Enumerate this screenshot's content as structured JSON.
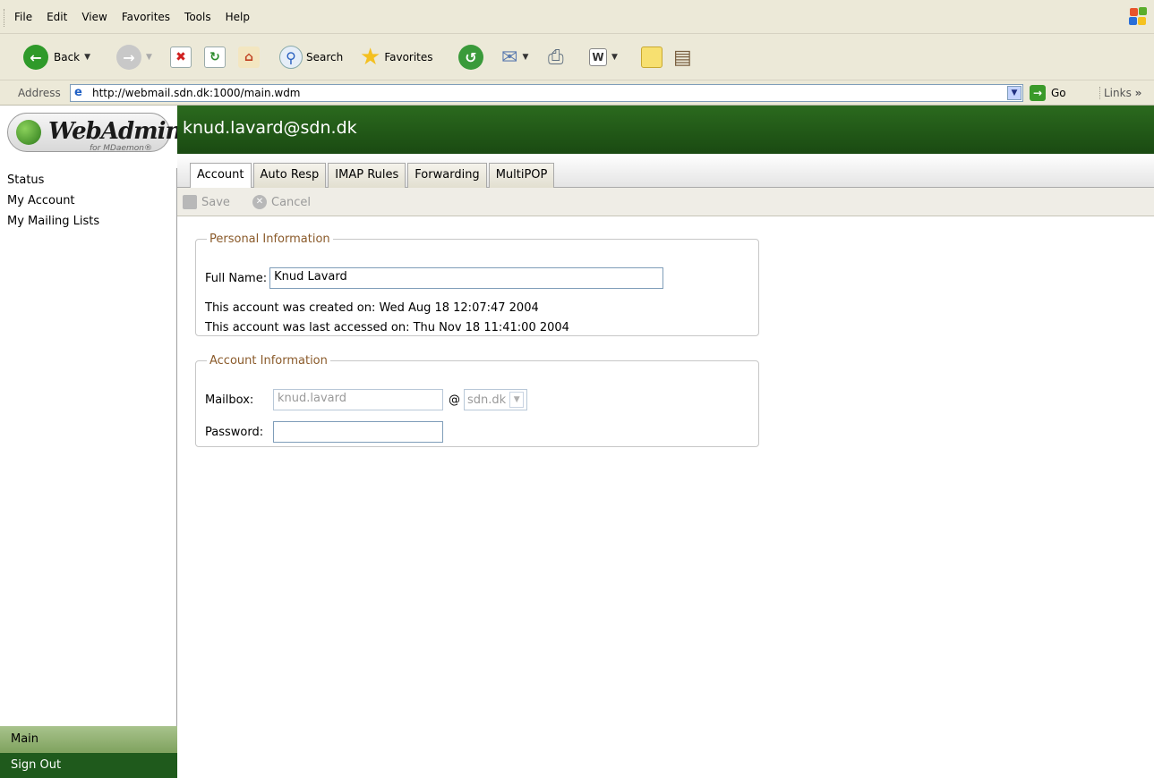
{
  "browser": {
    "menu": [
      "File",
      "Edit",
      "View",
      "Favorites",
      "Tools",
      "Help"
    ],
    "toolbar": {
      "back_label": "Back",
      "search_label": "Search",
      "favorites_label": "Favorites"
    },
    "address": {
      "label": "Address",
      "url": "http://webmail.sdn.dk:1000/main.wdm",
      "go_label": "Go",
      "links_label": "Links"
    }
  },
  "sidebar": {
    "logo_text": "WebAdmin",
    "logo_sub": "for MDaemon®",
    "items": [
      {
        "label": "Status"
      },
      {
        "label": "My Account"
      },
      {
        "label": "My Mailing Lists"
      }
    ],
    "main_label": "Main",
    "signout_label": "Sign Out"
  },
  "header": {
    "title": "knud.lavard@sdn.dk"
  },
  "tabs": [
    {
      "label": "Account",
      "active": true
    },
    {
      "label": "Auto Resp"
    },
    {
      "label": "IMAP Rules"
    },
    {
      "label": "Forwarding"
    },
    {
      "label": "MultiPOP"
    }
  ],
  "actions": {
    "save_label": "Save",
    "cancel_label": "Cancel"
  },
  "personal": {
    "legend": "Personal Information",
    "fullname_label": "Full Name:",
    "fullname_value": "Knud Lavard",
    "created_text": "This account was created on: Wed Aug 18 12:07:47 2004",
    "accessed_text": "This account was last accessed on: Thu Nov 18 11:41:00 2004"
  },
  "account": {
    "legend": "Account Information",
    "mailbox_label": "Mailbox:",
    "mailbox_value": "knud.lavard",
    "at_sign": "@",
    "domain_value": "sdn.dk",
    "password_label": "Password:",
    "password_value": ""
  },
  "colors": {
    "header_green": "#1f5a1c",
    "legend_brown": "#8a5a2a"
  }
}
